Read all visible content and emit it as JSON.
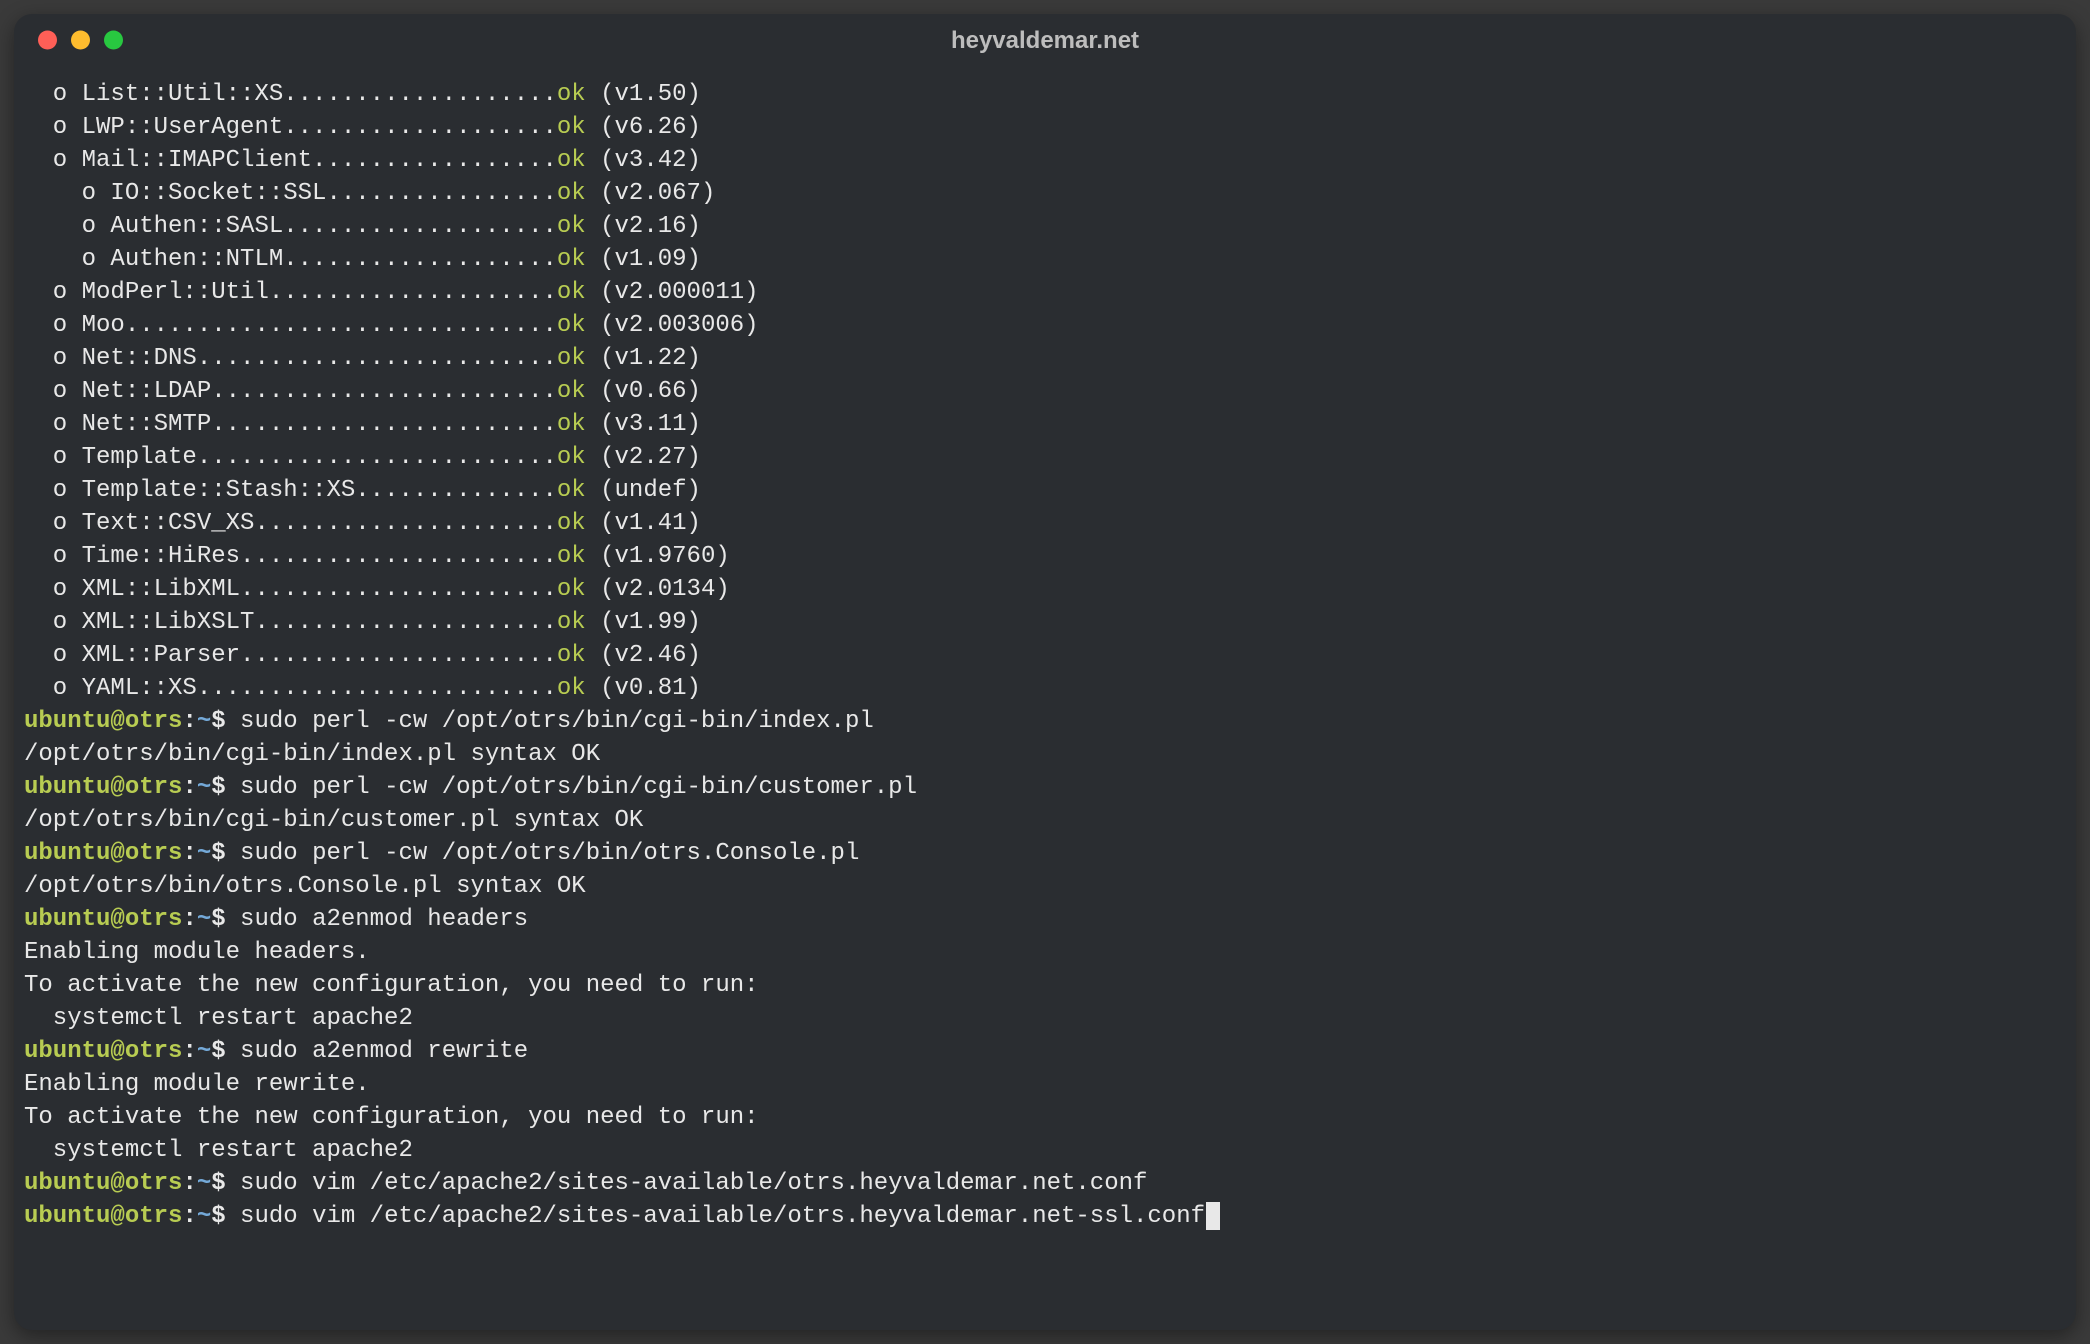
{
  "window": {
    "title": "heyvaldemar.net"
  },
  "prompt": {
    "userhost": "ubuntu@otrs",
    "sep": ":",
    "path": "~",
    "dollar": "$"
  },
  "modules": [
    {
      "indent": 1,
      "name": "List::Util::XS",
      "dots": "...................",
      "ver": "v1.50"
    },
    {
      "indent": 1,
      "name": "LWP::UserAgent",
      "dots": "...................",
      "ver": "v6.26"
    },
    {
      "indent": 1,
      "name": "Mail::IMAPClient",
      "dots": ".................",
      "ver": "v3.42"
    },
    {
      "indent": 2,
      "name": "IO::Socket::SSL",
      "dots": "................",
      "ver": "v2.067"
    },
    {
      "indent": 2,
      "name": "Authen::SASL",
      "dots": "...................",
      "ver": "v2.16"
    },
    {
      "indent": 2,
      "name": "Authen::NTLM",
      "dots": "...................",
      "ver": "v1.09"
    },
    {
      "indent": 1,
      "name": "ModPerl::Util",
      "dots": "....................",
      "ver": "v2.000011"
    },
    {
      "indent": 1,
      "name": "Moo",
      "dots": "..............................",
      "ver": "v2.003006"
    },
    {
      "indent": 1,
      "name": "Net::DNS",
      "dots": ".........................",
      "ver": "v1.22"
    },
    {
      "indent": 1,
      "name": "Net::LDAP",
      "dots": "........................",
      "ver": "v0.66"
    },
    {
      "indent": 1,
      "name": "Net::SMTP",
      "dots": "........................",
      "ver": "v3.11"
    },
    {
      "indent": 1,
      "name": "Template",
      "dots": ".........................",
      "ver": "v2.27"
    },
    {
      "indent": 1,
      "name": "Template::Stash::XS",
      "dots": "..............",
      "ver": "undef"
    },
    {
      "indent": 1,
      "name": "Text::CSV_XS",
      "dots": ".....................",
      "ver": "v1.41"
    },
    {
      "indent": 1,
      "name": "Time::HiRes",
      "dots": "......................",
      "ver": "v1.9760"
    },
    {
      "indent": 1,
      "name": "XML::LibXML",
      "dots": "......................",
      "ver": "v2.0134"
    },
    {
      "indent": 1,
      "name": "XML::LibXSLT",
      "dots": ".....................",
      "ver": "v1.99"
    },
    {
      "indent": 1,
      "name": "XML::Parser",
      "dots": "......................",
      "ver": "v2.46"
    },
    {
      "indent": 1,
      "name": "YAML::XS",
      "dots": ".........................",
      "ver": "v0.81"
    }
  ],
  "ok_label": "ok",
  "commands": [
    {
      "cmd": " sudo perl -cw /opt/otrs/bin/cgi-bin/index.pl",
      "out": [
        "/opt/otrs/bin/cgi-bin/index.pl syntax OK"
      ]
    },
    {
      "cmd": " sudo perl -cw /opt/otrs/bin/cgi-bin/customer.pl",
      "out": [
        "/opt/otrs/bin/cgi-bin/customer.pl syntax OK"
      ]
    },
    {
      "cmd": " sudo perl -cw /opt/otrs/bin/otrs.Console.pl",
      "out": [
        "/opt/otrs/bin/otrs.Console.pl syntax OK"
      ]
    },
    {
      "cmd": " sudo a2enmod headers",
      "out": [
        "Enabling module headers.",
        "To activate the new configuration, you need to run:",
        "  systemctl restart apache2"
      ]
    },
    {
      "cmd": " sudo a2enmod rewrite",
      "out": [
        "Enabling module rewrite.",
        "To activate the new configuration, you need to run:",
        "  systemctl restart apache2"
      ]
    },
    {
      "cmd": " sudo vim /etc/apache2/sites-available/otrs.heyvaldemar.net.conf",
      "out": []
    },
    {
      "cmd": " sudo vim /etc/apache2/sites-available/otrs.heyvaldemar.net-ssl.conf",
      "out": [],
      "cursor": true
    }
  ]
}
